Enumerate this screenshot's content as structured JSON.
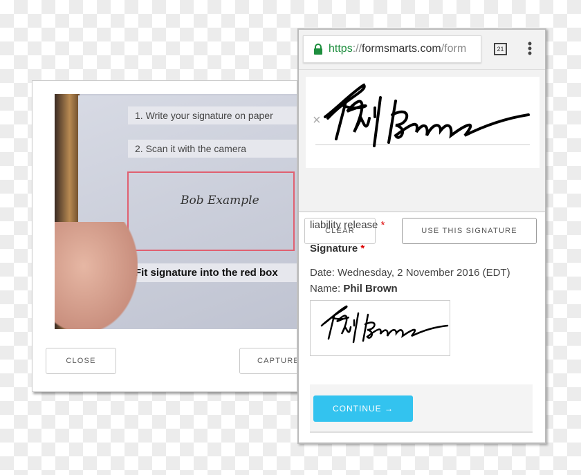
{
  "camera_dialog": {
    "step1": "1. Write your signature on paper",
    "step2": "2. Scan it with the camera",
    "sample_signature": "Bob Example",
    "hint": "Fit signature into the red box",
    "close_label": "CLOSE",
    "capture_label": "CAPTURE"
  },
  "browser": {
    "url_scheme": "https",
    "url_sep": "://",
    "url_domain": "formsmarts.com",
    "url_path": "/form",
    "tab_count": "21",
    "menu_icon": "⋮"
  },
  "signature_pad": {
    "clear_icon": "×",
    "clear_label": "CLEAR",
    "use_label": "USE THIS SIGNATURE"
  },
  "form": {
    "field_label": "liability release",
    "signature_label": "Signature",
    "required_mark": "*",
    "date_line": "Date: Wednesday, 2 November 2016 (EDT)",
    "name_prefix": "Name:",
    "name_value": "Phil Brown",
    "continue_label": "CONTINUE →"
  },
  "colors": {
    "accent": "#33c3ef",
    "required": "#dd0000",
    "lock": "#1e8e3e",
    "guide_box": "#e06070"
  }
}
